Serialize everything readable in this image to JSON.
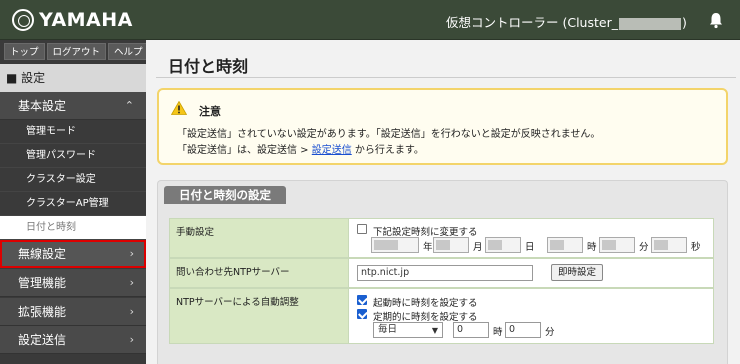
{
  "header": {
    "logo_text": "YAMAHA",
    "controller_prefix": "仮想コントローラー (Cluster_",
    "controller_suffix": ")",
    "bell_icon": "bell-icon"
  },
  "sidebar": {
    "toplinks": [
      "トップ",
      "ログアウト",
      "ヘルプ"
    ],
    "settings_header": "■ 設定",
    "basic_settings": "基本設定",
    "sub_items": [
      "管理モード",
      "管理パスワード",
      "クラスター設定",
      "クラスターAP管理",
      "日付と時刻"
    ],
    "groups": [
      "無線設定",
      "管理機能",
      "拡張機能",
      "設定送信"
    ]
  },
  "main": {
    "page_title": "日付と時刻",
    "notice": {
      "title": "注意",
      "line1": "「設定送信」されていない設定があります。「設定送信」を行わないと設定が反映されません。",
      "line2_prefix": "「設定送信」は、設定送信 > ",
      "line2_link": "設定送信",
      "line2_suffix": " から行えます。"
    },
    "section_title": "日付と時刻の設定",
    "manual": {
      "label": "手動設定",
      "checkbox_label": "下記設定時刻に変更する",
      "units": [
        "年",
        "月",
        "日",
        "時",
        "分",
        "秒"
      ]
    },
    "ntp_server": {
      "label": "問い合わせ先NTPサーバー",
      "value": "ntp.nict.jp",
      "button": "即時設定"
    },
    "auto": {
      "label": "NTPサーバーによる自動調整",
      "startup_label": "起動時に時刻を設定する",
      "periodic_label": "定期的に時刻を設定する",
      "frequency": "毎日",
      "hour": "0",
      "hour_unit": "時",
      "minute": "0",
      "minute_unit": "分"
    }
  },
  "colors": {
    "header_bg": "#3b4a38",
    "sidebar_bg": "#3a3a3a",
    "label_bg": "#d9e8c4",
    "notice_border": "#f3d46a",
    "highlight": "#d00000"
  }
}
